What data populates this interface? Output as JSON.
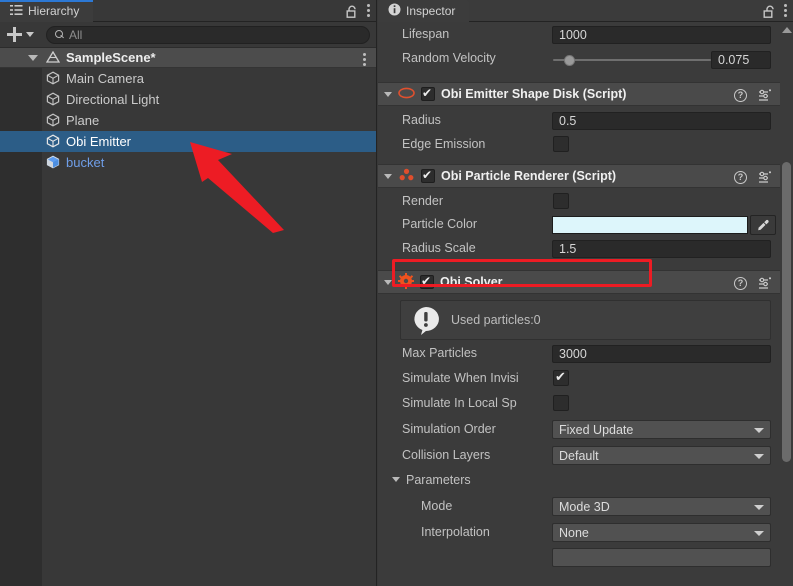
{
  "hierarchy": {
    "tab_label": "Hierarchy",
    "tab_icon": "hierarchy-list-icon",
    "lock_icon": "lock-open-icon",
    "menu_icon": "kebab-menu-icon",
    "toolbar": {
      "create_label": "+",
      "create_icon": "plus-icon",
      "dropdown_icon": "chevron-down-icon",
      "search_placeholder": "All",
      "search_value": "",
      "search_icon": "search-icon"
    },
    "scene": {
      "name": "SampleScene*",
      "icon": "unity-scene-icon",
      "expanded": true,
      "menu_icon": "kebab-menu-icon"
    },
    "items": [
      {
        "label": "Main Camera",
        "icon": "gameobject-cube-icon",
        "selected": false,
        "prefab": false
      },
      {
        "label": "Directional Light",
        "icon": "gameobject-cube-icon",
        "selected": false,
        "prefab": false
      },
      {
        "label": "Plane",
        "icon": "gameobject-cube-icon",
        "selected": false,
        "prefab": false
      },
      {
        "label": "Obi Emitter",
        "icon": "gameobject-cube-icon",
        "selected": true,
        "prefab": false
      },
      {
        "label": "bucket",
        "icon": "prefab-cube-icon",
        "selected": false,
        "prefab": true
      }
    ]
  },
  "inspector": {
    "tab_label": "Inspector",
    "tab_icon": "info-circle-icon",
    "lock_icon": "lock-open-icon",
    "menu_icon": "kebab-menu-icon",
    "top_fields": [
      {
        "label": "Lifespan",
        "value": "1000",
        "type": "text"
      },
      {
        "label": "Random Velocity",
        "value": "0.075",
        "type": "slider"
      }
    ],
    "components": [
      {
        "title": "Obi Emitter Shape Disk (Script)",
        "icon": "disk-ellipse-icon",
        "enabled": true,
        "expanded": true,
        "help_icon": "help-icon",
        "preset_icon": "preset-icon",
        "menu_icon": "kebab-menu-icon",
        "fields": [
          {
            "label": "Radius",
            "value": "0.5",
            "type": "text"
          },
          {
            "label": "Edge Emission",
            "value": "",
            "type": "checkbox",
            "checked": false
          }
        ]
      },
      {
        "title": "Obi Particle Renderer (Script)",
        "icon": "particles-icon",
        "enabled": true,
        "expanded": true,
        "help_icon": "help-icon",
        "preset_icon": "preset-icon",
        "menu_icon": "kebab-menu-icon",
        "fields": [
          {
            "label": "Render",
            "value": "",
            "type": "checkbox",
            "checked": false
          },
          {
            "label": "Particle Color",
            "value": "",
            "type": "color",
            "color": "#ddf6fb",
            "eyedropper_icon": "eyedropper-icon"
          },
          {
            "label": "Radius Scale",
            "value": "1.5",
            "type": "text",
            "highlighted": true
          }
        ]
      },
      {
        "title": "Obi Solver",
        "icon": "gear-icon",
        "enabled": true,
        "expanded": true,
        "help_icon": "help-icon",
        "preset_icon": "preset-icon",
        "menu_icon": "kebab-menu-icon",
        "info": {
          "text": "Used particles:0",
          "icon": "info-exclamation-icon"
        },
        "fields": [
          {
            "label": "Max Particles",
            "value": "3000",
            "type": "text"
          },
          {
            "label": "Simulate When Invisi",
            "value": "",
            "type": "checkbox",
            "checked": true
          },
          {
            "label": "Simulate In Local Sp",
            "value": "",
            "type": "checkbox",
            "checked": false
          },
          {
            "label": "Simulation Order",
            "value": "Fixed Update",
            "type": "dropdown"
          },
          {
            "label": "Collision Layers",
            "value": "Default",
            "type": "dropdown"
          }
        ],
        "subsection": {
          "label": "Parameters",
          "expanded": true,
          "fields": [
            {
              "label": "Mode",
              "value": "Mode 3D",
              "type": "dropdown"
            },
            {
              "label": "Interpolation",
              "value": "None",
              "type": "dropdown"
            }
          ]
        }
      }
    ]
  },
  "annotations": {
    "highlight_color": "#ed1c24",
    "arrow_color": "#ed1c24",
    "highlight_target": "Radius Scale",
    "arrow_target": "Obi Emitter"
  },
  "colors": {
    "selection_blue": "#2c5d87",
    "prefab_blue": "#6f9ee8",
    "accent_tab": "#2c78d4",
    "panel_bg": "#383838",
    "inspector_bg": "#3b3b3b"
  }
}
